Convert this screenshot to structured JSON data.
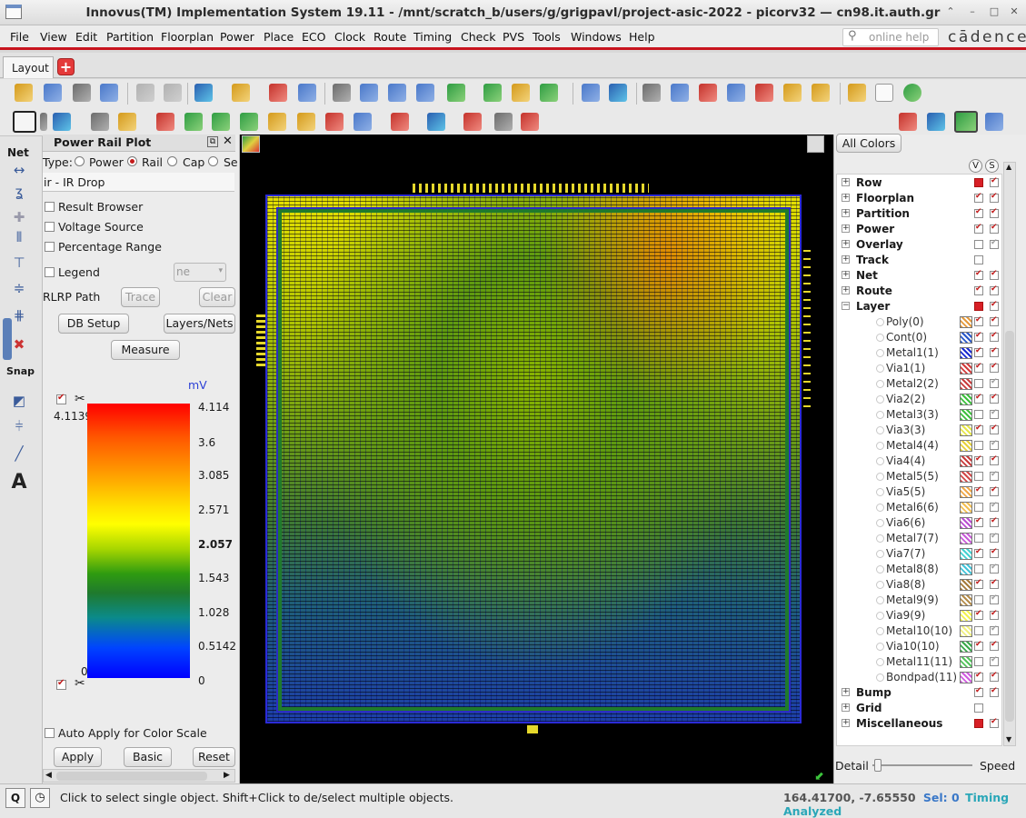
{
  "window": {
    "title": "Innovus(TM) Implementation System 19.11 - /mnt/scratch_b/users/g/grigpavl/project-asic-2022 - picorv32 — cn98.it.auth.gr"
  },
  "menu": [
    "File",
    "View",
    "Edit",
    "Partition",
    "Floorplan",
    "Power",
    "Place",
    "ECO",
    "Clock",
    "Route",
    "Timing",
    "Check",
    "PVS",
    "Tools",
    "Windows",
    "Help"
  ],
  "help_search": {
    "placeholder": "online help"
  },
  "brand": "cādence",
  "tabs": {
    "active": "Layout"
  },
  "left_tools": {
    "net": "Net",
    "snap": "Snap"
  },
  "power_rail_plot": {
    "title": "Power Rail Plot",
    "type_label": "Type:",
    "types": [
      "Power",
      "Rail",
      "Cap",
      "Se"
    ],
    "selected_type": "Rail",
    "analysis": "ir - IR Drop",
    "result_browser": "Result Browser",
    "voltage_source": "Voltage Source",
    "percentage_range": "Percentage Range",
    "legend": "Legend",
    "legend_select": "ne",
    "rlrp_path": "RLRP Path",
    "trace": "Trace",
    "clear": "Clear",
    "db_setup": "DB Setup",
    "layers_nets": "Layers/Nets",
    "measure": "Measure",
    "unit": "mV",
    "max_value": "4.1139",
    "min_value": "0",
    "scale_ticks": [
      "4.114",
      "3.6",
      "3.085",
      "2.571",
      "2.057",
      "1.543",
      "1.028",
      "0.5142",
      "0"
    ],
    "auto_apply": "Auto Apply for Color Scale",
    "apply": "Apply",
    "basic": "Basic",
    "reset": "Reset"
  },
  "right_panel": {
    "all_colors": "All Colors",
    "col_v": "V",
    "col_s": "S",
    "groups": [
      {
        "name": "Row",
        "v": "red",
        "s": "chk"
      },
      {
        "name": "Floorplan",
        "v": "chk",
        "s": "chk"
      },
      {
        "name": "Partition",
        "v": "chk",
        "s": "chk"
      },
      {
        "name": "Power",
        "v": "chk",
        "s": "chk"
      },
      {
        "name": "Overlay",
        "v": "empty",
        "s": "gray"
      },
      {
        "name": "Track",
        "v": "empty",
        "s": "none"
      },
      {
        "name": "Net",
        "v": "chk",
        "s": "chk"
      },
      {
        "name": "Route",
        "v": "chk",
        "s": "chk"
      }
    ],
    "layer_group": {
      "name": "Layer",
      "v": "red",
      "s": "chk"
    },
    "layers": [
      {
        "name": "Poly(0)",
        "color": "#e59a3c",
        "v": "chk",
        "s": "chk"
      },
      {
        "name": "Cont(0)",
        "color": "#2857c8",
        "v": "chk",
        "s": "chk"
      },
      {
        "name": "Metal1(1)",
        "color": "#1a2bd0",
        "v": "chk",
        "s": "chk"
      },
      {
        "name": "Via1(1)",
        "color": "#d13a3a",
        "v": "chk",
        "s": "chk"
      },
      {
        "name": "Metal2(2)",
        "color": "#c93c3c",
        "v": "empty",
        "s": "gray"
      },
      {
        "name": "Via2(2)",
        "color": "#3cbf3c",
        "v": "chk",
        "s": "chk"
      },
      {
        "name": "Metal3(3)",
        "color": "#3fbf3f",
        "v": "empty",
        "s": "gray"
      },
      {
        "name": "Via3(3)",
        "color": "#e6e64a",
        "v": "chk",
        "s": "chk"
      },
      {
        "name": "Metal4(4)",
        "color": "#e7d23a",
        "v": "empty",
        "s": "gray"
      },
      {
        "name": "Via4(4)",
        "color": "#c83a3a",
        "v": "chk",
        "s": "chk"
      },
      {
        "name": "Metal5(5)",
        "color": "#d24848",
        "v": "empty",
        "s": "gray"
      },
      {
        "name": "Via5(5)",
        "color": "#f0a848",
        "v": "chk",
        "s": "chk"
      },
      {
        "name": "Metal6(6)",
        "color": "#f3bf52",
        "v": "empty",
        "s": "gray"
      },
      {
        "name": "Via6(6)",
        "color": "#b94fd1",
        "v": "chk",
        "s": "chk"
      },
      {
        "name": "Metal7(7)",
        "color": "#c85bd8",
        "v": "empty",
        "s": "gray"
      },
      {
        "name": "Via7(7)",
        "color": "#44d2d2",
        "v": "chk",
        "s": "chk"
      },
      {
        "name": "Metal8(8)",
        "color": "#42c3d8",
        "v": "empty",
        "s": "gray"
      },
      {
        "name": "Via8(8)",
        "color": "#a67b3b",
        "v": "chk",
        "s": "chk"
      },
      {
        "name": "Metal9(9)",
        "color": "#b48c4a",
        "v": "empty",
        "s": "gray"
      },
      {
        "name": "Via9(9)",
        "color": "#f2f24f",
        "v": "chk",
        "s": "chk"
      },
      {
        "name": "Metal10(10)",
        "color": "#f0f080",
        "v": "empty",
        "s": "gray"
      },
      {
        "name": "Via10(10)",
        "color": "#3aa84a",
        "v": "chk",
        "s": "chk"
      },
      {
        "name": "Metal11(11)",
        "color": "#53c35b",
        "v": "empty",
        "s": "gray"
      },
      {
        "name": "Bondpad(11)",
        "color": "#d05ce0",
        "v": "chk",
        "s": "chk"
      }
    ],
    "groups_after": [
      {
        "name": "Bump",
        "v": "chk",
        "s": "chk"
      },
      {
        "name": "Grid",
        "v": "empty",
        "s": "none"
      },
      {
        "name": "Miscellaneous",
        "v": "red",
        "s": "chk"
      }
    ],
    "detail": "Detail",
    "speed": "Speed"
  },
  "status": {
    "message": "Click to select single object. Shift+Click to de/select multiple objects.",
    "coords": "164.41700, -7.65550",
    "selection": "Sel: 0",
    "timing": "Timing Analyzed",
    "q": "Q"
  }
}
